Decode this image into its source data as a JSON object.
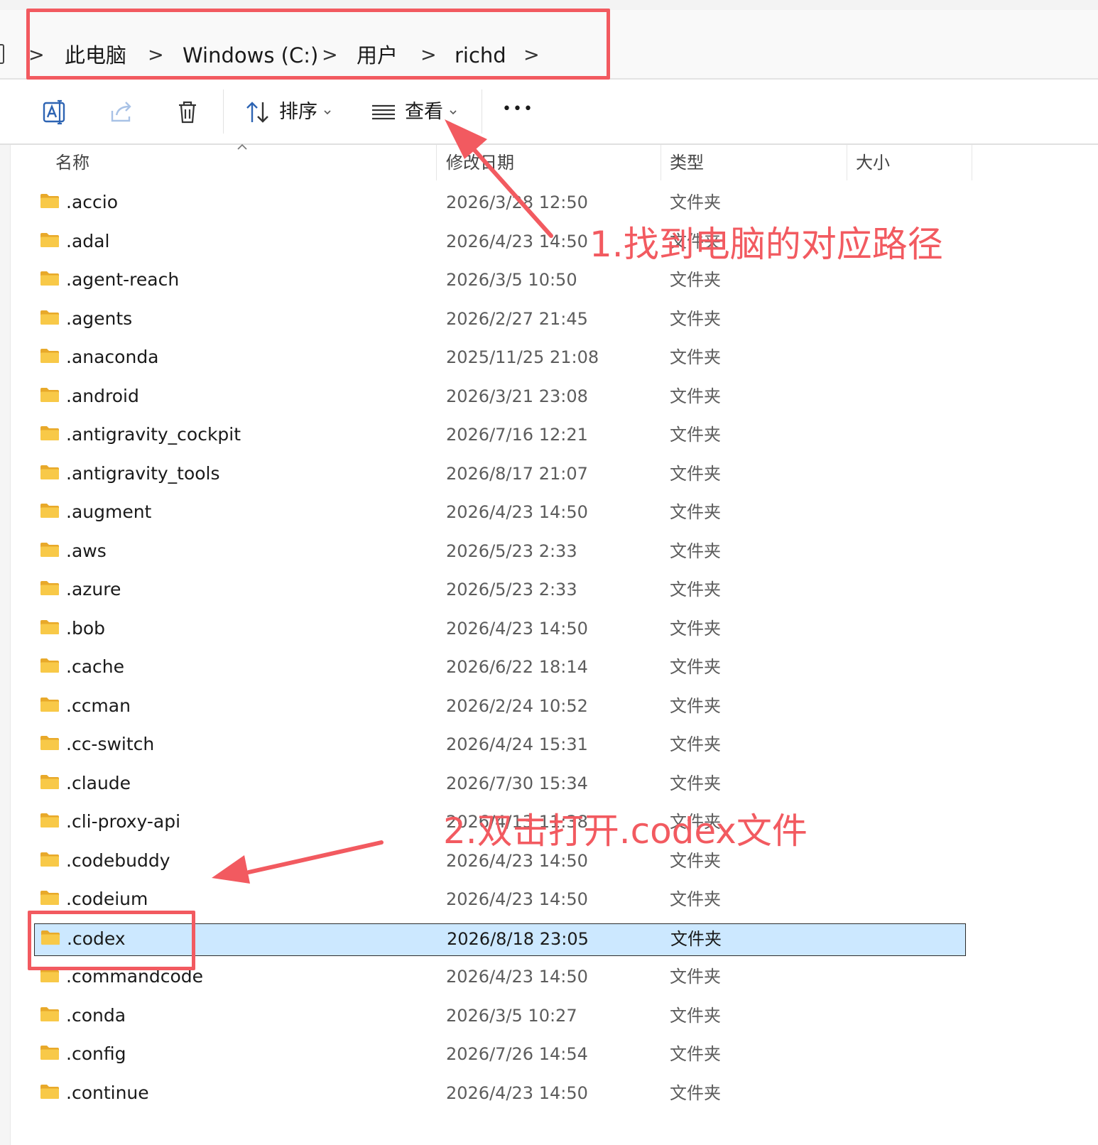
{
  "breadcrumb": {
    "items": [
      "此电脑",
      "Windows (C:)",
      "用户",
      "richd"
    ],
    "separator": ">"
  },
  "toolbar": {
    "sort_label": "排序",
    "view_label": "查看",
    "more_label": "•••"
  },
  "columns": {
    "name": "名称",
    "modified": "修改日期",
    "type": "类型",
    "size": "大小"
  },
  "files": [
    {
      "name": ".accio",
      "modified": "2026/3/28 12:50",
      "type": "文件夹"
    },
    {
      "name": ".adal",
      "modified": "2026/4/23 14:50",
      "type": "文件夹"
    },
    {
      "name": ".agent-reach",
      "modified": "2026/3/5 10:50",
      "type": "文件夹"
    },
    {
      "name": ".agents",
      "modified": "2026/2/27 21:45",
      "type": "文件夹"
    },
    {
      "name": ".anaconda",
      "modified": "2025/11/25 21:08",
      "type": "文件夹"
    },
    {
      "name": ".android",
      "modified": "2026/3/21 23:08",
      "type": "文件夹"
    },
    {
      "name": ".antigravity_cockpit",
      "modified": "2026/7/16 12:21",
      "type": "文件夹"
    },
    {
      "name": ".antigravity_tools",
      "modified": "2026/8/17 21:07",
      "type": "文件夹"
    },
    {
      "name": ".augment",
      "modified": "2026/4/23 14:50",
      "type": "文件夹"
    },
    {
      "name": ".aws",
      "modified": "2026/5/23 2:33",
      "type": "文件夹"
    },
    {
      "name": ".azure",
      "modified": "2026/5/23 2:33",
      "type": "文件夹"
    },
    {
      "name": ".bob",
      "modified": "2026/4/23 14:50",
      "type": "文件夹"
    },
    {
      "name": ".cache",
      "modified": "2026/6/22 18:14",
      "type": "文件夹"
    },
    {
      "name": ".ccman",
      "modified": "2026/2/24 10:52",
      "type": "文件夹"
    },
    {
      "name": ".cc-switch",
      "modified": "2026/4/24 15:31",
      "type": "文件夹"
    },
    {
      "name": ".claude",
      "modified": "2026/7/30 15:34",
      "type": "文件夹"
    },
    {
      "name": ".cli-proxy-api",
      "modified": "2026/4/13 11:38",
      "type": "文件夹"
    },
    {
      "name": ".codebuddy",
      "modified": "2026/4/23 14:50",
      "type": "文件夹"
    },
    {
      "name": ".codeium",
      "modified": "2026/4/23 14:50",
      "type": "文件夹"
    },
    {
      "name": ".codex",
      "modified": "2026/8/18 23:05",
      "type": "文件夹",
      "selected": true
    },
    {
      "name": ".commandcode",
      "modified": "2026/4/23 14:50",
      "type": "文件夹"
    },
    {
      "name": ".conda",
      "modified": "2026/3/5 10:27",
      "type": "文件夹"
    },
    {
      "name": ".config",
      "modified": "2026/7/26 14:54",
      "type": "文件夹"
    },
    {
      "name": ".continue",
      "modified": "2026/4/23 14:50",
      "type": "文件夹"
    }
  ],
  "annotations": {
    "step1": "1.找到电脑的对应路径",
    "step2": "2.双击打开.codex文件"
  },
  "colors": {
    "annotation": "#f25a60",
    "selection": "#cce8ff",
    "folder": "#f8c948"
  }
}
